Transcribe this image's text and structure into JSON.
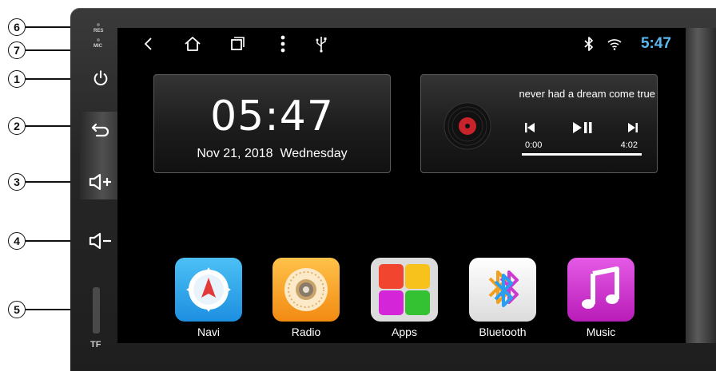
{
  "callouts": [
    "6",
    "7",
    "1",
    "2",
    "3",
    "4",
    "5"
  ],
  "side_panel": {
    "res_label": "RES",
    "mic_label": "MIC",
    "tf_label": "TF"
  },
  "status_bar": {
    "nav_icons": [
      "back-icon",
      "home-icon",
      "recents-icon",
      "menu-dots-icon",
      "usb-icon"
    ],
    "status_icons": [
      "bluetooth-icon",
      "wifi-icon"
    ],
    "time": "5:47"
  },
  "clock_widget": {
    "time": "05:47",
    "date": "Nov 21, 2018",
    "weekday": "Wednesday"
  },
  "music_widget": {
    "song_title": "never had a dream come true",
    "elapsed": "0:00",
    "duration": "4:02",
    "progress": 1.0
  },
  "apps": [
    {
      "label": "Navi",
      "icon": "compass-icon"
    },
    {
      "label": "Radio",
      "icon": "radio-icon"
    },
    {
      "label": "Apps",
      "icon": "apps-grid-icon"
    },
    {
      "label": "Bluetooth",
      "icon": "bluetooth-app-icon"
    },
    {
      "label": "Music",
      "icon": "music-note-icon"
    }
  ],
  "colors": {
    "status_time": "#5ab8f0",
    "navi_tile": "#2da3ec",
    "radio_tile": "#f7a21c",
    "bluetooth_tile": "#f2f2f2",
    "music_tile": "#d02ed0"
  }
}
